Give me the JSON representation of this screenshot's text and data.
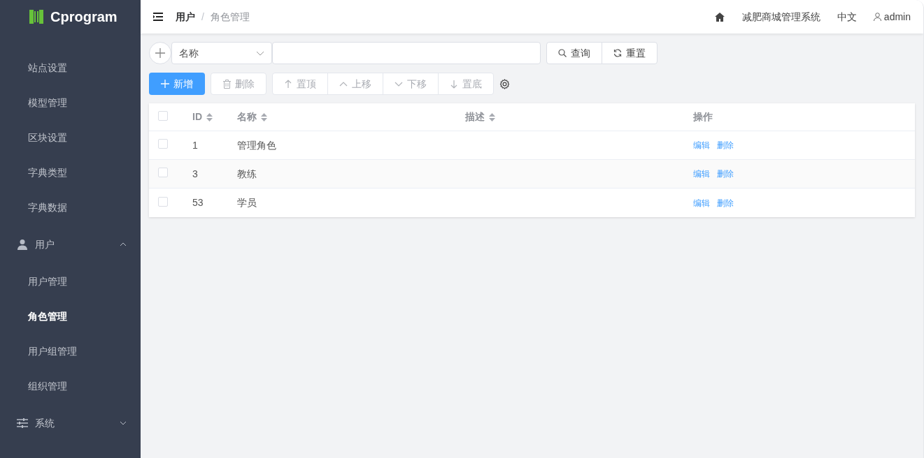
{
  "logo": {
    "text": "Cprogram"
  },
  "sidebar": {
    "items": [
      {
        "kind": "item",
        "label": "站点设置",
        "selected": false
      },
      {
        "kind": "item",
        "label": "模型管理",
        "selected": false
      },
      {
        "kind": "item",
        "label": "区块设置",
        "selected": false
      },
      {
        "kind": "item",
        "label": "字典类型",
        "selected": false
      },
      {
        "kind": "item",
        "label": "字典数据",
        "selected": false
      },
      {
        "kind": "group",
        "label": "用户",
        "expanded": true,
        "children": [
          {
            "kind": "item",
            "label": "用户管理",
            "selected": false
          },
          {
            "kind": "item",
            "label": "角色管理",
            "selected": true
          },
          {
            "kind": "item",
            "label": "用户组管理",
            "selected": false
          },
          {
            "kind": "item",
            "label": "组织管理",
            "selected": false
          }
        ]
      },
      {
        "kind": "group",
        "label": "系统",
        "expanded": false
      }
    ]
  },
  "header": {
    "breadcrumb": [
      "用户",
      "角色管理"
    ],
    "breadcrumb_separator": "/",
    "system_name": "减肥商城管理系统",
    "language": "中文",
    "user": "admin"
  },
  "search": {
    "field": "名称",
    "buttons": [
      {
        "label": "查询"
      },
      {
        "label": "重置"
      }
    ]
  },
  "toolbar": {
    "add": "新增",
    "delete": "删除",
    "move_buttons": [
      {
        "label": "置顶"
      },
      {
        "label": "上移"
      },
      {
        "label": "下移"
      },
      {
        "label": "置底"
      }
    ]
  },
  "table": {
    "all_checked": false,
    "columns": [
      {
        "label": "ID",
        "sortable": true
      },
      {
        "label": "名称",
        "sortable": true
      },
      {
        "label": "描述",
        "sortable": true
      },
      {
        "label": "操作",
        "sortable": false
      }
    ],
    "rows": [
      {
        "checked": false,
        "id": "1",
        "name": "管理角色",
        "actions": [
          "编辑",
          "删除"
        ]
      },
      {
        "checked": false,
        "id": "3",
        "name": "教练",
        "actions": [
          "编辑",
          "删除"
        ]
      },
      {
        "checked": false,
        "id": "53",
        "name": "学员",
        "actions": [
          "编辑",
          "删除"
        ]
      }
    ]
  }
}
